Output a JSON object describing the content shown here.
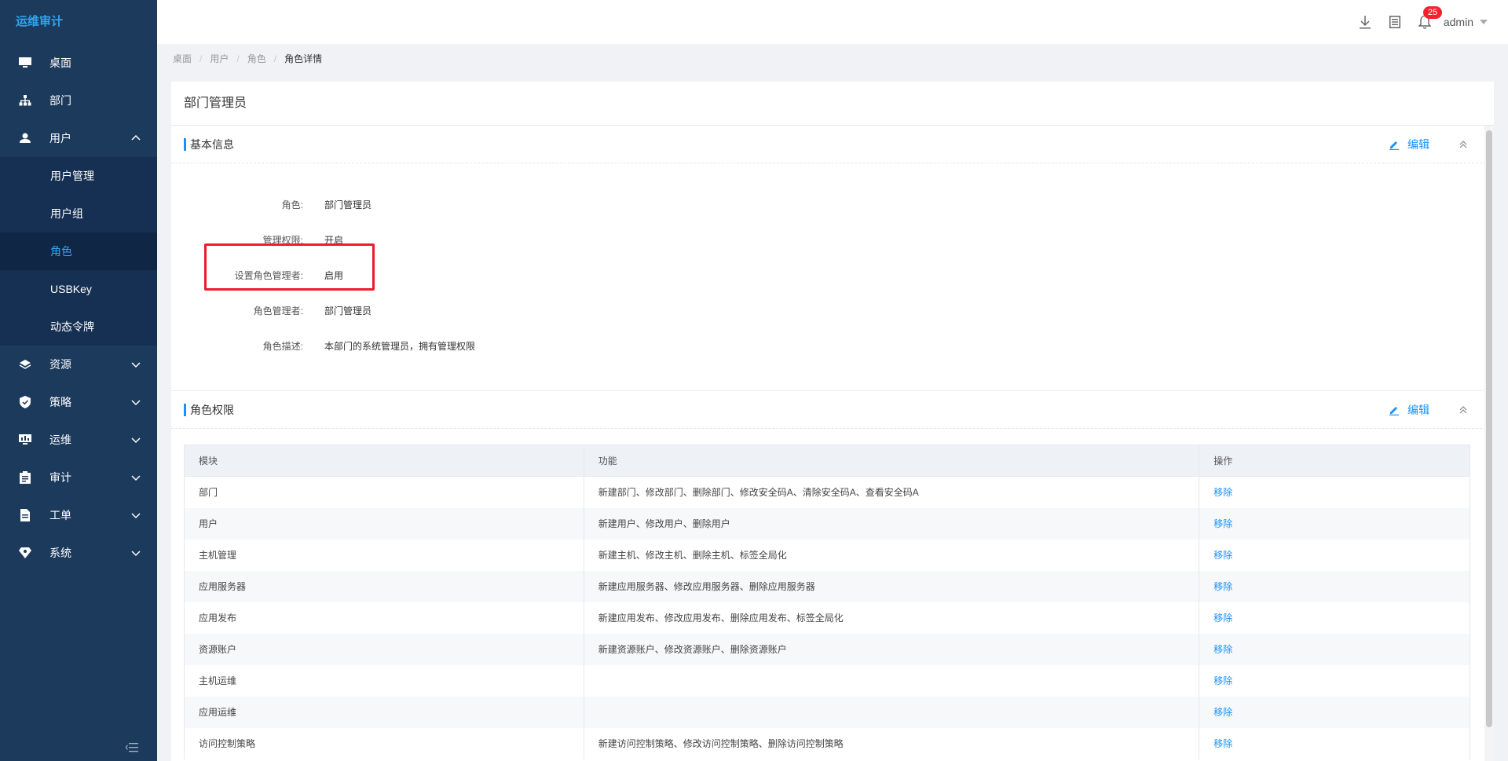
{
  "app": {
    "title": "运维审计"
  },
  "sidebar": {
    "items": [
      {
        "label": "桌面",
        "icon": "desktop-icon"
      },
      {
        "label": "部门",
        "icon": "org-icon"
      },
      {
        "label": "用户",
        "icon": "user-icon",
        "expanded": true
      },
      {
        "label": "资源",
        "icon": "layers-icon"
      },
      {
        "label": "策略",
        "icon": "shield-icon"
      },
      {
        "label": "运维",
        "icon": "monitor-icon"
      },
      {
        "label": "审计",
        "icon": "audit-icon"
      },
      {
        "label": "工单",
        "icon": "ticket-icon"
      },
      {
        "label": "系统",
        "icon": "system-icon"
      }
    ],
    "sub_items": [
      {
        "label": "用户管理"
      },
      {
        "label": "用户组"
      },
      {
        "label": "角色",
        "active": true
      },
      {
        "label": "USBKey"
      },
      {
        "label": "动态令牌"
      }
    ]
  },
  "header": {
    "notification_count": "25",
    "username": "admin"
  },
  "breadcrumb": {
    "items": [
      "桌面",
      "用户",
      "角色"
    ],
    "current": "角色详情"
  },
  "page": {
    "title": "部门管理员"
  },
  "basic_info": {
    "section_title": "基本信息",
    "edit_label": "编辑",
    "rows": [
      {
        "label": "角色:",
        "value": "部门管理员"
      },
      {
        "label": "管理权限:",
        "value": "开启"
      },
      {
        "label": "设置角色管理者:",
        "value": "启用"
      },
      {
        "label": "角色管理者:",
        "value": "部门管理员"
      },
      {
        "label": "角色描述:",
        "value": "本部门的系统管理员，拥有管理权限"
      }
    ]
  },
  "permissions": {
    "section_title": "角色权限",
    "edit_label": "编辑",
    "columns": [
      "模块",
      "功能",
      "操作"
    ],
    "rows": [
      {
        "module": "部门",
        "functions": "新建部门、修改部门、删除部门、修改安全码A、清除安全码A、查看安全码A",
        "action": "移除"
      },
      {
        "module": "用户",
        "functions": "新建用户、修改用户、删除用户",
        "action": "移除"
      },
      {
        "module": "主机管理",
        "functions": "新建主机、修改主机、删除主机、标签全局化",
        "action": "移除"
      },
      {
        "module": "应用服务器",
        "functions": "新建应用服务器、修改应用服务器、删除应用服务器",
        "action": "移除"
      },
      {
        "module": "应用发布",
        "functions": "新建应用发布、修改应用发布、删除应用发布、标签全局化",
        "action": "移除"
      },
      {
        "module": "资源账户",
        "functions": "新建资源账户、修改资源账户、删除资源账户",
        "action": "移除"
      },
      {
        "module": "主机运维",
        "functions": "",
        "action": "移除"
      },
      {
        "module": "应用运维",
        "functions": "",
        "action": "移除"
      },
      {
        "module": "访问控制策略",
        "functions": "新建访问控制策略、修改访问控制策略、删除访问控制策略",
        "action": "移除"
      }
    ]
  },
  "colors": {
    "sidebar_bg": "#1c3a5c",
    "accent": "#1890ff",
    "highlight": "#ec1b2e",
    "badge": "#f5222d"
  }
}
